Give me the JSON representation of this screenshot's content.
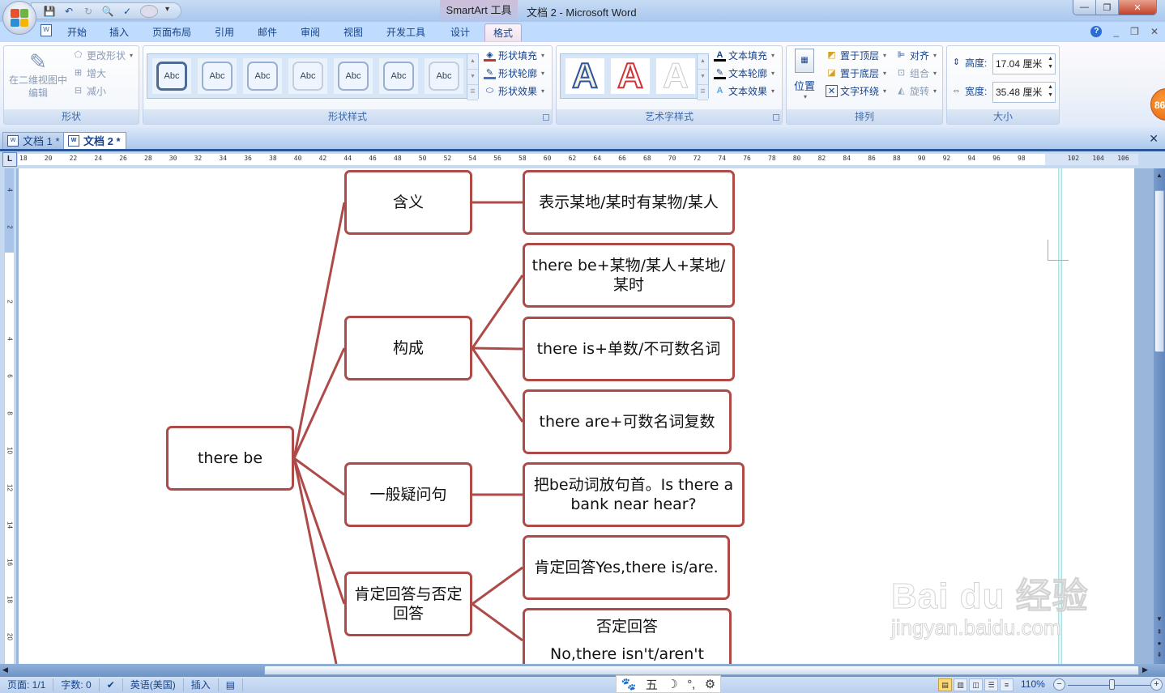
{
  "titlebar": {
    "context_tab_title": "SmartArt 工具",
    "window_title": "文档 2 - Microsoft Word",
    "qat_icons": [
      "save-icon",
      "undo-icon",
      "redo-icon",
      "print-preview-icon",
      "spelling-icon",
      "circle-icon"
    ]
  },
  "ribbon_tabs": [
    {
      "label": "开始"
    },
    {
      "label": "插入"
    },
    {
      "label": "页面布局"
    },
    {
      "label": "引用"
    },
    {
      "label": "邮件"
    },
    {
      "label": "审阅"
    },
    {
      "label": "视图"
    },
    {
      "label": "开发工具"
    },
    {
      "label": "设计"
    },
    {
      "label": "格式",
      "active": true
    }
  ],
  "ribbon": {
    "shape_group": {
      "label": "形状",
      "edit_2d": "在二维视图中编辑",
      "change_shape": "更改形状",
      "larger": "增大",
      "smaller": "减小"
    },
    "shape_styles_group": {
      "label": "形状样式",
      "thumb_text": "Abc",
      "thumb_count": 7,
      "fill": "形状填充",
      "outline": "形状轮廓",
      "effects": "形状效果"
    },
    "wordart_group": {
      "label": "艺术字样式",
      "glyph": "A",
      "text_fill": "文本填充",
      "text_outline": "文本轮廓",
      "text_effects": "文本效果"
    },
    "arrange_group": {
      "label": "排列",
      "position": "位置",
      "bring_front": "置于顶层",
      "send_back": "置于底层",
      "text_wrap": "文字环绕",
      "align": "对齐",
      "group": "组合",
      "rotate": "旋转"
    },
    "size_group": {
      "label": "大小",
      "height_label": "高度:",
      "height_value": "17.04 厘米",
      "width_label": "宽度:",
      "width_value": "35.48 厘米"
    },
    "badge": "86"
  },
  "doc_tabs": [
    {
      "label": "文档 1 *",
      "active": false
    },
    {
      "label": "文档 2 *",
      "active": true
    }
  ],
  "ruler": {
    "h_ticks": [
      "18",
      "20",
      "22",
      "24",
      "26",
      "28",
      "30",
      "32",
      "34",
      "36",
      "38",
      "40",
      "42",
      "44",
      "46",
      "48",
      "50",
      "52",
      "54",
      "56",
      "58",
      "60",
      "62",
      "64",
      "66",
      "68",
      "70",
      "72",
      "74",
      "76",
      "78",
      "80",
      "82",
      "84",
      "86",
      "88",
      "90",
      "92",
      "94",
      "96",
      "98",
      "",
      "102",
      "104",
      "106"
    ],
    "v_ticks": [
      "4",
      "2",
      "",
      "2",
      "4",
      "6",
      "8",
      "10",
      "12",
      "14",
      "16",
      "18",
      "20"
    ]
  },
  "diagram": {
    "root": "there be",
    "branches": [
      {
        "label": "含义",
        "children": [
          "表示某地/某时有某物/某人"
        ]
      },
      {
        "label": "构成",
        "children": [
          "there be+某物/某人+某地/某时",
          "there is+单数/不可数名词",
          "there are+可数名词复数"
        ]
      },
      {
        "label": "一般疑问句",
        "children": [
          "把be动词放句首。Is there a bank near hear?"
        ]
      },
      {
        "label": "肯定回答与否定回答",
        "children": [
          "肯定回答Yes,there is/are.",
          "否定回答\nNo,there isn't/aren't"
        ]
      }
    ],
    "line_color": "#ae4b49"
  },
  "watermark": {
    "main": "Bai du 经验",
    "sub": "jingyan.baidu.com"
  },
  "statusbar": {
    "page": "页面: 1/1",
    "words": "字数: 0",
    "language": "英语(美国)",
    "mode": "插入",
    "zoom": "110%"
  },
  "ime": {
    "items": [
      "🐾",
      "五",
      "☽",
      "°,",
      "⚙"
    ]
  }
}
